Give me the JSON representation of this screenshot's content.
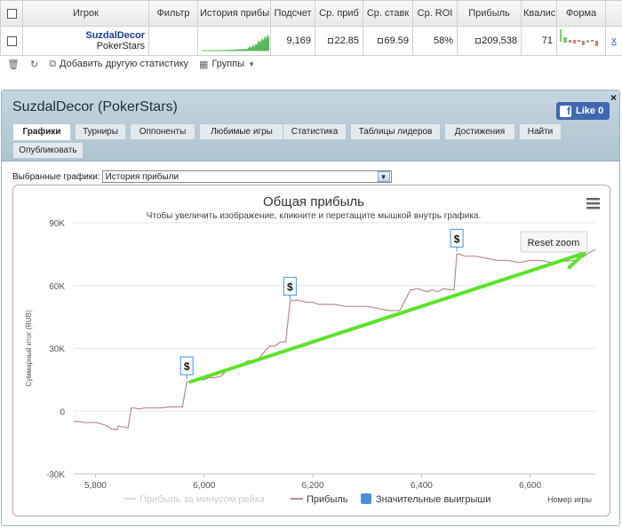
{
  "table": {
    "headers": [
      "Игрок",
      "Фильтр",
      "История прибы",
      "Подсчет",
      "Ср. приб",
      "Ср. ставк",
      "Ср. ROI",
      "Прибыль",
      "Квалис",
      "Форма"
    ],
    "row": {
      "player_name": "SuzdalDecor",
      "player_site": "PokerStars",
      "filter": "",
      "count": "9,169",
      "avg_profit": "22.85",
      "avg_stake": "69.59",
      "avg_roi": "58%",
      "profit": "209,538",
      "ability": "71",
      "remove": "x"
    }
  },
  "toolbar": {
    "add_stats": "Добавить другую статистику",
    "groups": "Группы"
  },
  "panel": {
    "title": "SuzdalDecor (PokerStars)",
    "close": "×",
    "like": "Like 0",
    "tabs": [
      "Графики",
      "Турниры",
      "Оппоненты",
      "Любимые игры",
      "Статистика",
      "Таблицы лидеров",
      "Достижения",
      "Найти",
      "Опубликовать"
    ],
    "active_tab": "Графики",
    "select_label": "Выбранные графики:",
    "select_value": "История прибыли"
  },
  "chart_data": {
    "type": "line",
    "title": "Общая прибыль",
    "subtitle": "Чтобы увеличить изображение, кликните и перетащите мышкой внутрь графика.",
    "xlabel": "Номер игры",
    "ylabel": "Суммарный итог (RUB)",
    "xlim": [
      5760,
      6720
    ],
    "ylim": [
      -30000,
      90000
    ],
    "x_ticks": [
      "5,800",
      "6,000",
      "6,200",
      "6,400",
      "6,600"
    ],
    "y_ticks": [
      "90K",
      "60K",
      "30K",
      "0",
      "-30K"
    ],
    "reset_zoom": "Reset zoom",
    "legend": [
      "Прибыль за минусом рейка",
      "Прибыль",
      "Значительные выигрыши"
    ],
    "legend_placement": "bottom",
    "series": [
      {
        "name": "Прибыль",
        "color": "#b98a8e",
        "x": [
          5760,
          5770,
          5780,
          5790,
          5800,
          5810,
          5820,
          5830,
          5840,
          5842,
          5850,
          5860,
          5866,
          5870,
          5880,
          5890,
          5900,
          5910,
          5920,
          5930,
          5940,
          5950,
          5960,
          5968,
          5970,
          5980,
          5990,
          6000,
          6010,
          6020,
          6030,
          6040,
          6050,
          6060,
          6070,
          6080,
          6090,
          6100,
          6110,
          6120,
          6130,
          6140,
          6150,
          6158,
          6160,
          6170,
          6180,
          6190,
          6200,
          6210,
          6220,
          6240,
          6260,
          6280,
          6300,
          6320,
          6340,
          6360,
          6380,
          6385,
          6390,
          6400,
          6410,
          6420,
          6430,
          6440,
          6450,
          6460,
          6465,
          6470,
          6480,
          6500,
          6520,
          6540,
          6560,
          6580,
          6600,
          6620,
          6640,
          6660,
          6680,
          6700,
          6710,
          6720
        ],
        "y": [
          -5000,
          -5000,
          -5500,
          -5500,
          -5500,
          -6000,
          -7000,
          -8500,
          -9000,
          -7000,
          -7500,
          -8000,
          1500,
          1500,
          1000,
          1500,
          1500,
          1500,
          1500,
          1800,
          2000,
          2000,
          2000,
          14000,
          14000,
          14500,
          15000,
          15000,
          16000,
          16000,
          16500,
          19000,
          20500,
          21000,
          22000,
          24000,
          24000,
          25000,
          28000,
          31000,
          31000,
          33000,
          33000,
          52000,
          53000,
          53000,
          52500,
          52000,
          52000,
          51000,
          51000,
          51000,
          50000,
          50000,
          50000,
          49000,
          48000,
          48000,
          58000,
          58000,
          58500,
          58000,
          57000,
          58000,
          57000,
          58500,
          58000,
          58000,
          75000,
          75000,
          74000,
          74000,
          73000,
          72000,
          72000,
          71000,
          72000,
          72000,
          71000,
          71500,
          72000,
          74000,
          76000,
          77000
        ]
      }
    ],
    "big_wins_x": [
      5968,
      6158,
      6465
    ],
    "big_wins_label": "$",
    "big_wins_color": "#4a90d9",
    "trend_arrow_color": "#5be32a"
  }
}
